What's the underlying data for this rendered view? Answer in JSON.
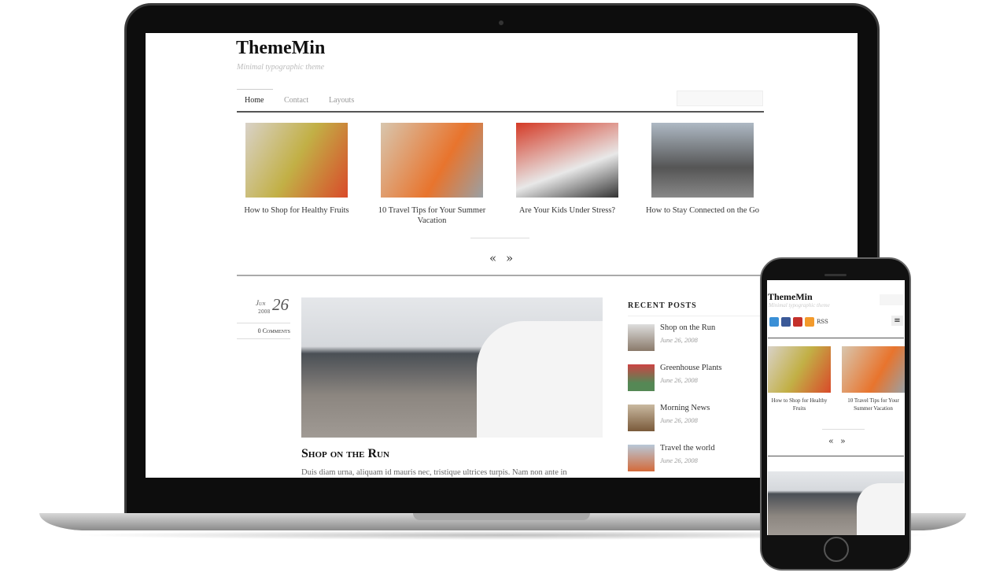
{
  "site": {
    "title": "ThemeMin",
    "tagline": "Minimal typographic theme"
  },
  "nav": [
    {
      "label": "Home",
      "active": true
    },
    {
      "label": "Contact"
    },
    {
      "label": "Layouts"
    }
  ],
  "search": {
    "placeholder": ""
  },
  "featured": [
    {
      "caption": "How to Shop for Healthy Fruits"
    },
    {
      "caption": "10 Travel Tips for Your Summer Vacation"
    },
    {
      "caption": "Are Your Kids Under Stress?"
    },
    {
      "caption": "How to Stay Connected on the Go"
    }
  ],
  "slider": {
    "prev": "«",
    "next": "»"
  },
  "post": {
    "month": "Jun",
    "day": "26",
    "year": "2008",
    "comments": "0 Comments",
    "title": "Shop on the Run",
    "excerpt": "Duis diam urna, aliquam id mauris nec, tristique ultrices turpis. Nam non ante in"
  },
  "sidebar": {
    "heading": "Recent Posts",
    "items": [
      {
        "title": "Shop on the Run",
        "date": "June 26, 2008"
      },
      {
        "title": "Greenhouse Plants",
        "date": "June 26, 2008"
      },
      {
        "title": "Morning News",
        "date": "June 26, 2008"
      },
      {
        "title": "Travel the world",
        "date": "June 26, 2008"
      }
    ]
  },
  "mobile": {
    "social": [
      {
        "icon": "twitter-icon",
        "color": "#3a8fd6"
      },
      {
        "icon": "facebook-icon",
        "color": "#3b5998"
      },
      {
        "icon": "youtube-icon",
        "color": "#c4302b"
      },
      {
        "icon": "rss-icon",
        "color": "#f39a2b"
      }
    ],
    "rss_label": "RSS",
    "menu_icon": "hamburger-icon"
  }
}
